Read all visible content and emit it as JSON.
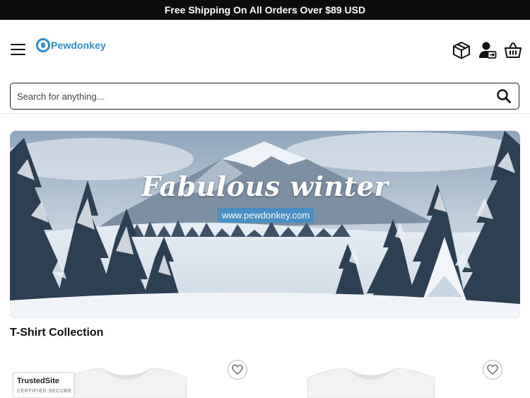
{
  "announcement": {
    "text": "Free Shipping On All Orders Over $89 USD"
  },
  "header": {
    "logo_text": "Pewdonkey",
    "menu_icon": "hamburger-menu-icon",
    "icons": [
      "package-icon",
      "account-icon",
      "cart-basket-icon"
    ]
  },
  "search": {
    "placeholder": "Search for anything...",
    "value": "",
    "button_icon": "search-icon"
  },
  "banner": {
    "title": "Fabulous winter",
    "url_text": "www.pewdonkey.com"
  },
  "collection": {
    "title": "T-Shirt Collection"
  },
  "products": [
    {
      "wishlist_icon": "heart-icon"
    },
    {
      "wishlist_icon": "heart-icon"
    }
  ],
  "trust_badge": {
    "name": "TrustedSite",
    "subtitle": "CERTIFIED SECURE"
  },
  "colors": {
    "brand": "#2a8fd6",
    "topbar": "#0c0c0c",
    "badge": "#4a8ec4"
  }
}
